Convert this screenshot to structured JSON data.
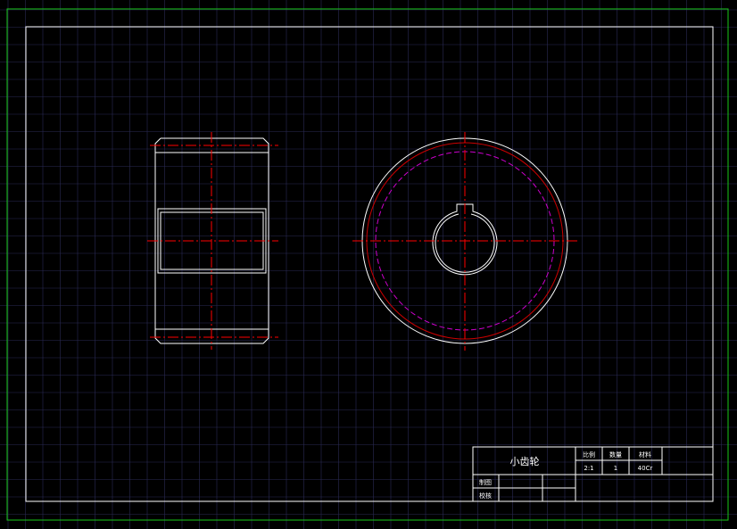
{
  "title_block": {
    "part_name": "小齿轮",
    "headers": {
      "scale": "比例",
      "quantity": "数量",
      "material": "材料"
    },
    "values": {
      "scale": "2:1",
      "quantity": "1",
      "material": "40Cr"
    },
    "rows": {
      "drawn_by": "制图",
      "checked_by": "校核"
    }
  },
  "colors": {
    "background": "#000000",
    "grid": "#2a2a55",
    "outer_border": "#19c819",
    "geometry": "#ffffff",
    "centerline": "#ff0000",
    "pitch_circle": "#cc00cc",
    "addendum_circle": "#cc0000"
  }
}
